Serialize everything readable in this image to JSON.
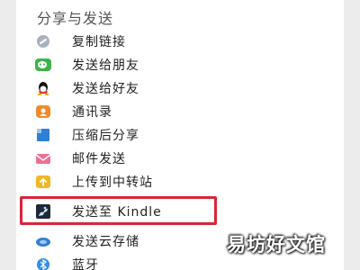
{
  "header": {
    "title": "分享与发送"
  },
  "items": [
    {
      "label": "复制链接",
      "icon": "link-icon"
    },
    {
      "label": "发送给朋友",
      "icon": "wechat-icon"
    },
    {
      "label": "发送给好友",
      "icon": "qq-icon"
    },
    {
      "label": "通讯录",
      "icon": "contacts-icon"
    },
    {
      "label": "压缩后分享",
      "icon": "compress-icon"
    },
    {
      "label": "邮件发送",
      "icon": "mail-icon"
    },
    {
      "label": "上传到中转站",
      "icon": "upload-icon"
    },
    {
      "label": "发送至 Kindle",
      "icon": "kindle-icon"
    },
    {
      "label": "发送云存储",
      "icon": "cloud-icon"
    },
    {
      "label": "蓝牙",
      "icon": "bluetooth-icon"
    }
  ],
  "highlight": {
    "color": "#d9243b",
    "item_label": "发送至 Kindle"
  },
  "watermark": {
    "text": "易坊好文馆"
  }
}
